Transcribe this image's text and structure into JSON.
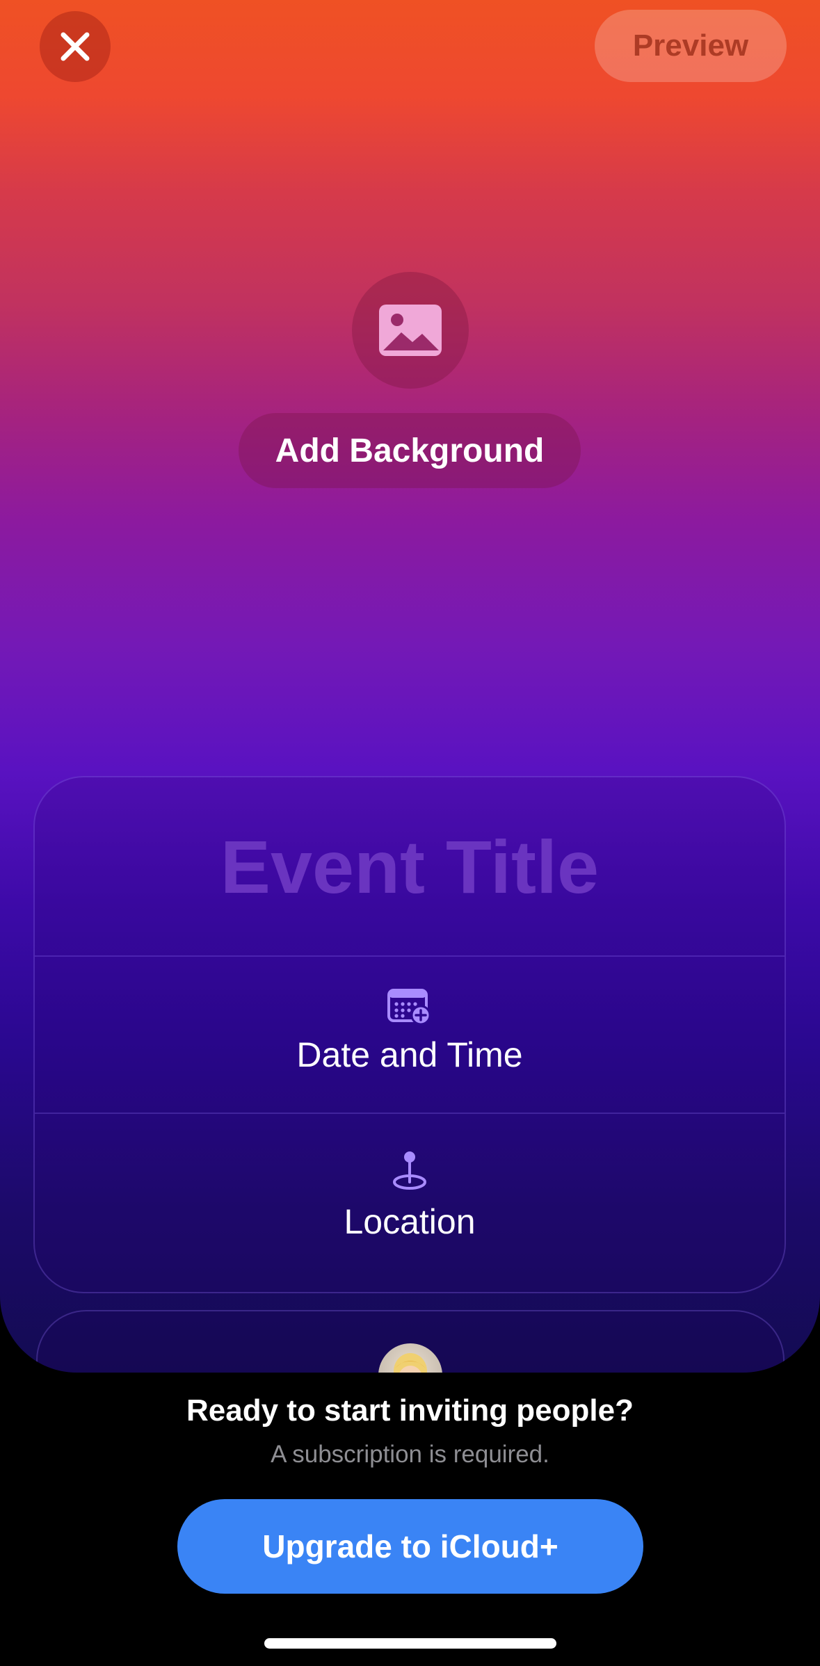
{
  "header": {
    "close_icon": "xmark-icon",
    "preview_label": "Preview"
  },
  "background": {
    "photo_icon": "photo-icon",
    "add_label": "Add Background"
  },
  "card": {
    "title_placeholder": "Event Title",
    "date_icon": "calendar-plus-icon",
    "date_label": "Date and Time",
    "location_icon": "location-pin-icon",
    "location_label": "Location"
  },
  "host": {
    "avatar_icon": "memoji-avatar"
  },
  "footer": {
    "headline": "Ready to start inviting people?",
    "subtext": "A subscription is required.",
    "upgrade_label": "Upgrade to iCloud+"
  },
  "colors": {
    "accent": "#3a84f5",
    "gradient_top": "#ef5124",
    "gradient_mid": "#7419b6",
    "gradient_bottom": "#130b52",
    "title_placeholder": "#6a34c0",
    "icon_purple": "#a98cff"
  }
}
